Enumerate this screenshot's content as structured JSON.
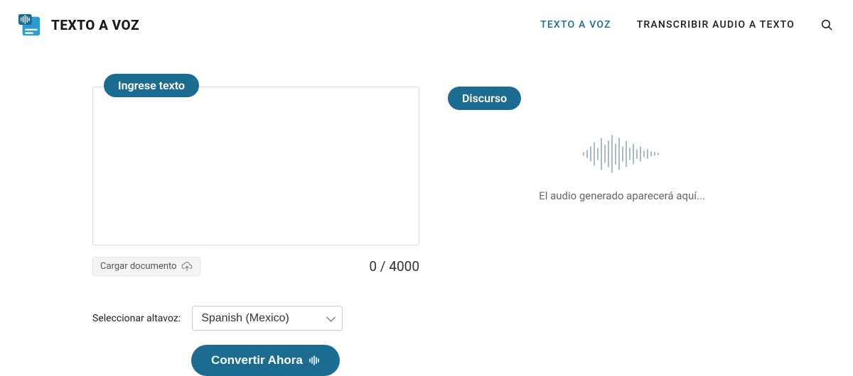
{
  "header": {
    "brand": "TEXTO A VOZ",
    "nav": {
      "tts": "TEXTO A VOZ",
      "stt": "TRANSCRIBIR AUDIO A TEXTO"
    }
  },
  "input": {
    "pill": "Ingrese texto",
    "textarea_value": "",
    "upload_label": "Cargar documento",
    "counter": "0 / 4000"
  },
  "speaker": {
    "label": "Seleccionar altavoz:",
    "selected": "Spanish (Mexico)"
  },
  "convert": {
    "label": "Convertir Ahora"
  },
  "output": {
    "pill": "Discurso",
    "placeholder": "El audio generado aparecerá aquí..."
  }
}
